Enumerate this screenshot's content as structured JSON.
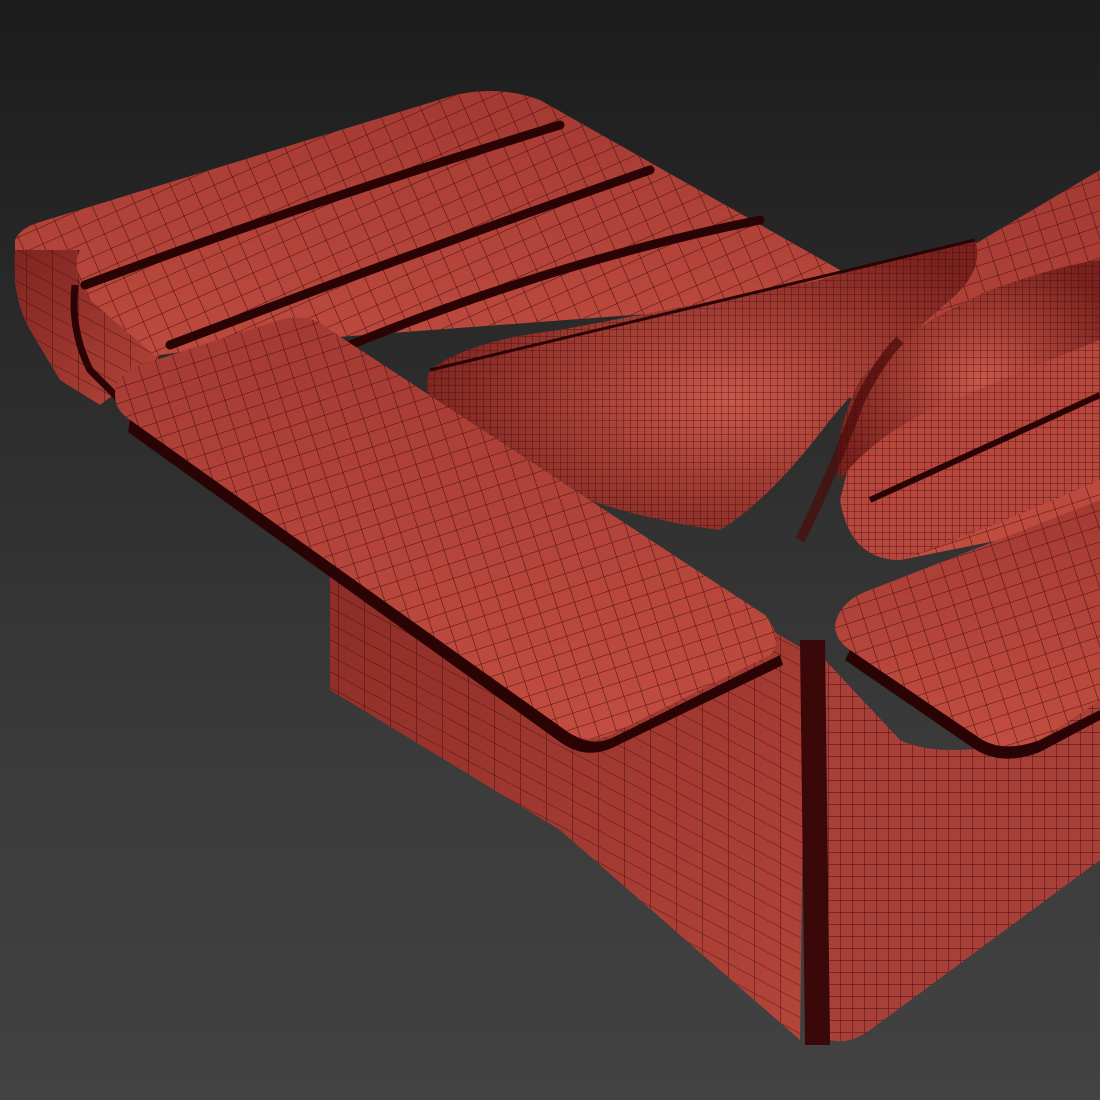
{
  "viewport": {
    "background_top": "#1c1c1c",
    "background_bottom": "#424242"
  },
  "model": {
    "subject": "sofa-wireframe-render",
    "shading_color": "#b8473c",
    "shading_dark": "#6e1a18",
    "wire_color": "#3a0808"
  }
}
